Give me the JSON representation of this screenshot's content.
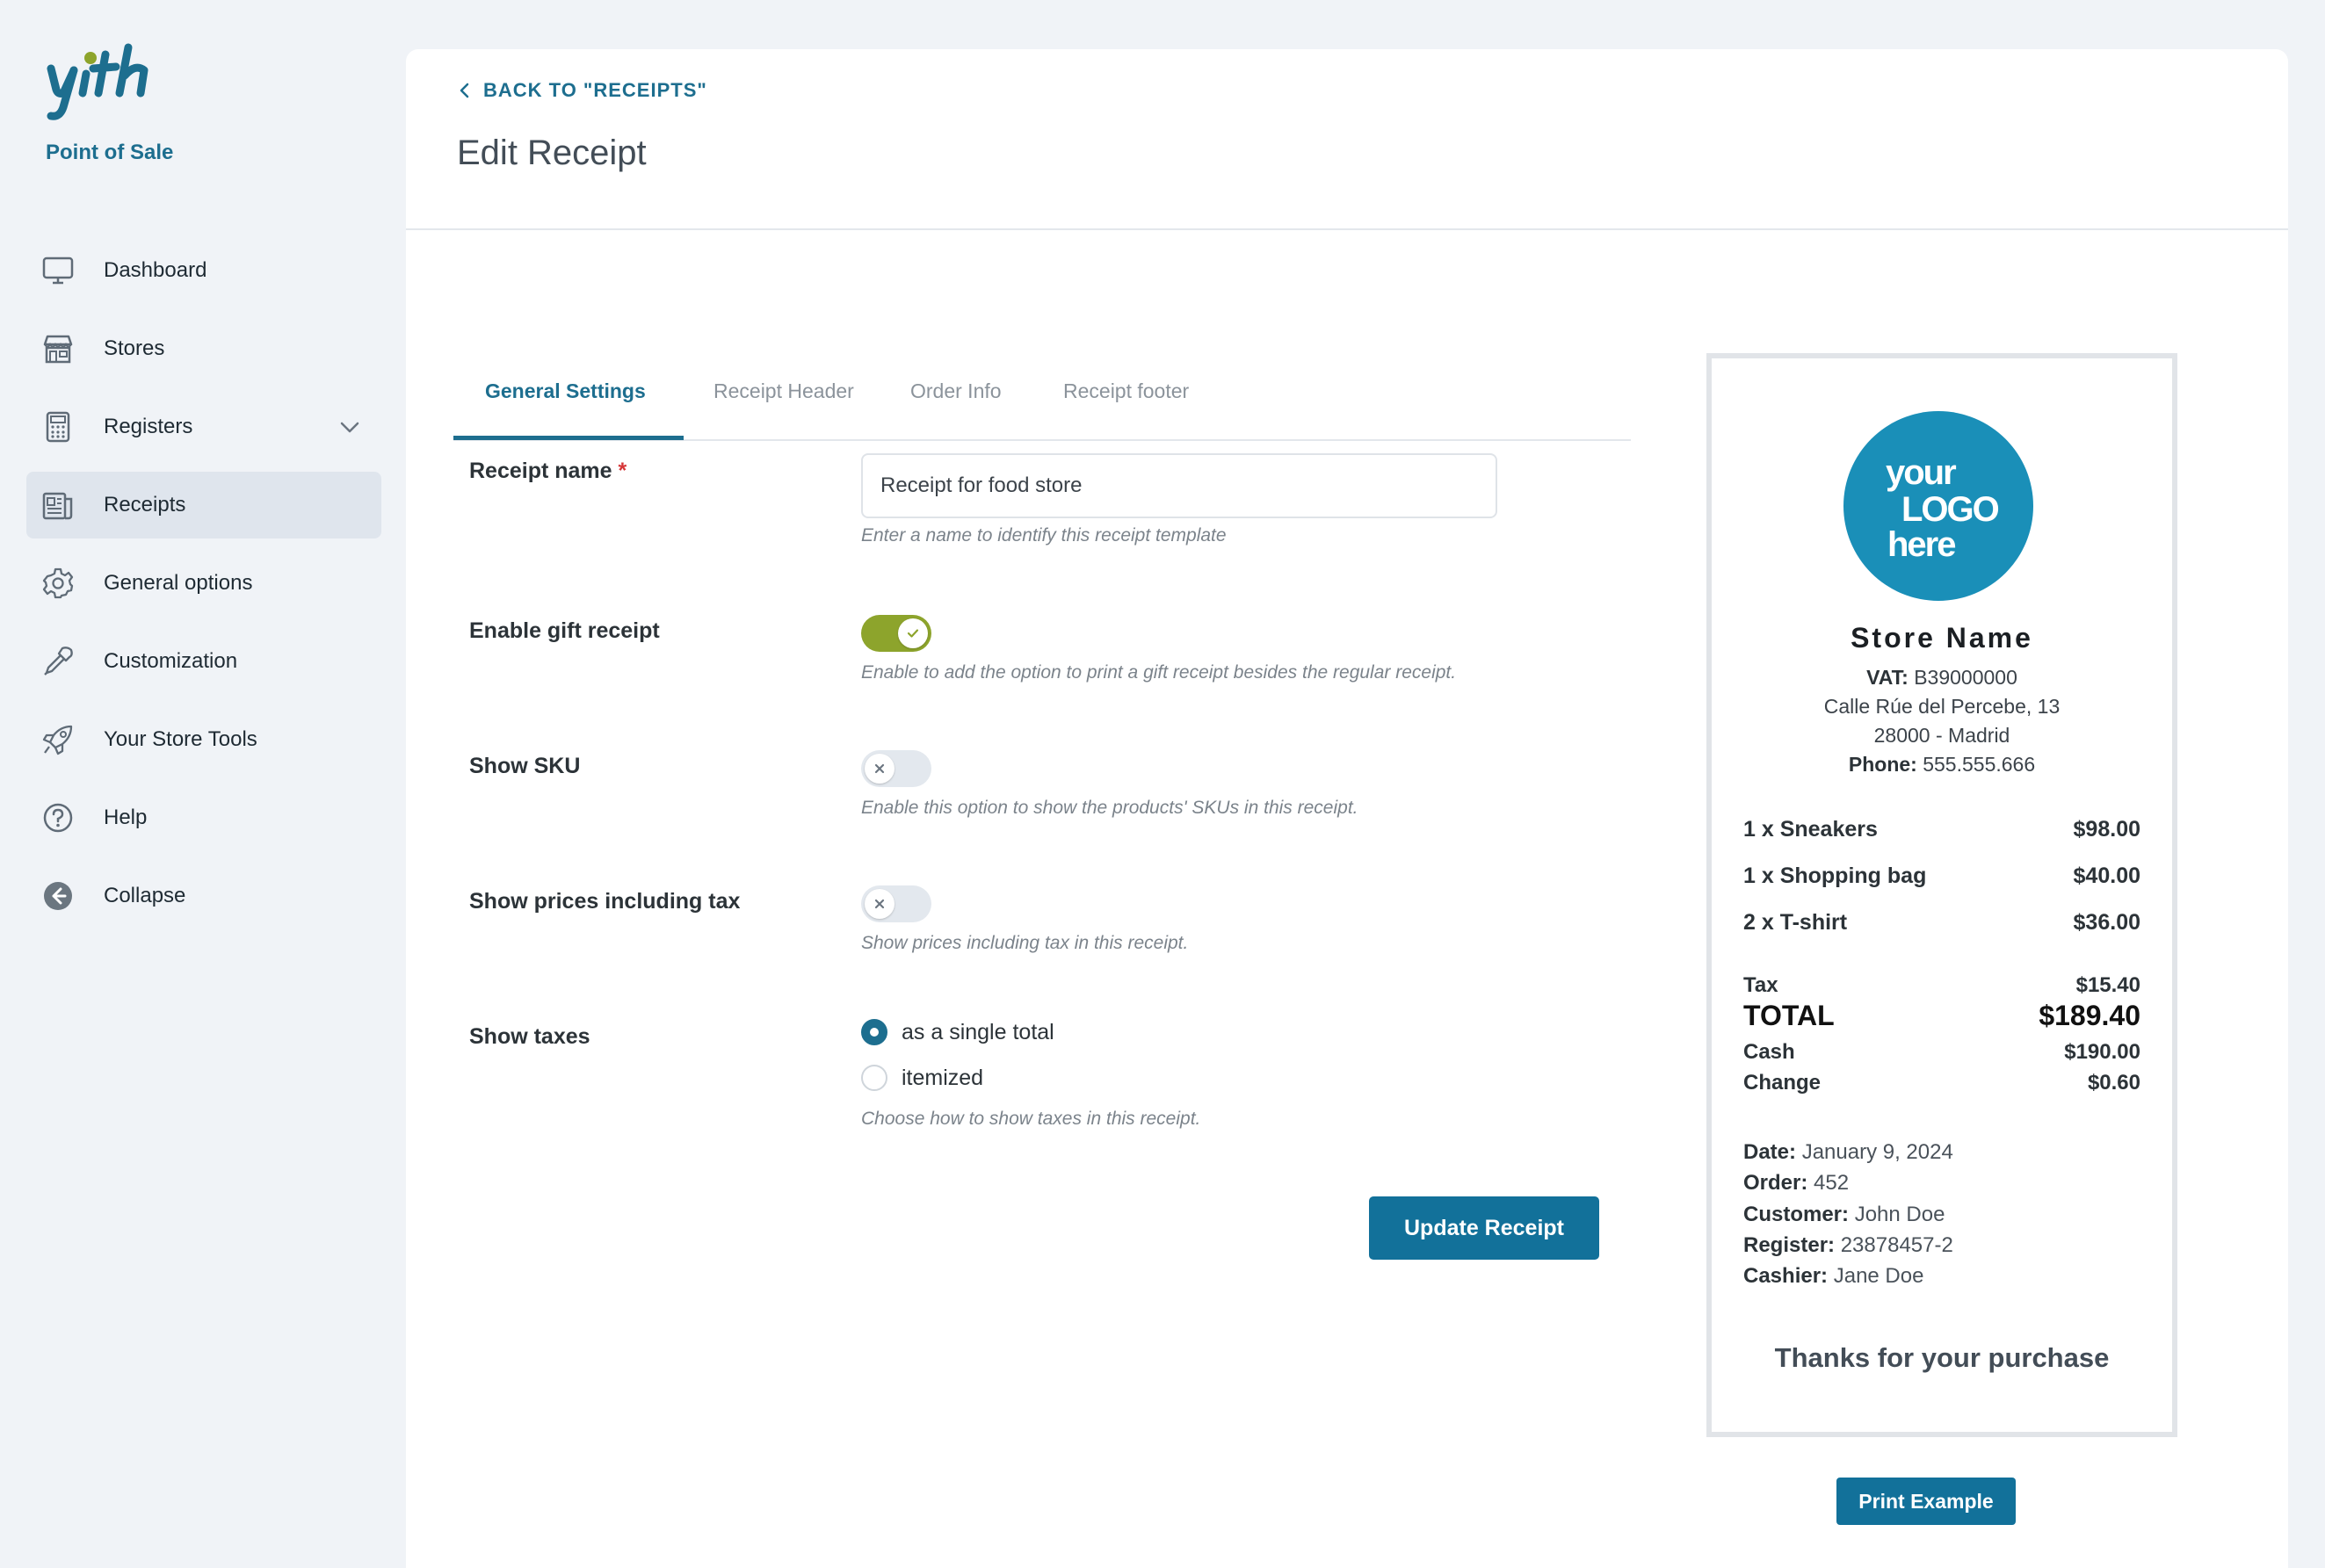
{
  "brand": {
    "logo_text": "yith",
    "app_name": "Point of Sale",
    "accent_color": "#1d6e8f",
    "logo_dot_color": "#8da42c"
  },
  "sidebar": {
    "items": [
      {
        "label": "Dashboard",
        "icon": "monitor-icon"
      },
      {
        "label": "Stores",
        "icon": "store-icon"
      },
      {
        "label": "Registers",
        "icon": "calculator-icon",
        "expandable": true
      },
      {
        "label": "Receipts",
        "icon": "receipt-icon",
        "active": true
      },
      {
        "label": "General options",
        "icon": "gear-icon"
      },
      {
        "label": "Customization",
        "icon": "eyedropper-icon"
      },
      {
        "label": "Your Store Tools",
        "icon": "rocket-icon"
      },
      {
        "label": "Help",
        "icon": "help-icon"
      },
      {
        "label": "Collapse",
        "icon": "collapse-arrow-icon"
      }
    ]
  },
  "header": {
    "back_label": "BACK TO \"RECEIPTS\"",
    "title": "Edit Receipt"
  },
  "tabs": [
    {
      "label": "General Settings",
      "active": true
    },
    {
      "label": "Receipt Header"
    },
    {
      "label": "Order Info"
    },
    {
      "label": "Receipt footer"
    }
  ],
  "form": {
    "receipt_name": {
      "label": "Receipt name",
      "required_mark": "*",
      "value": "Receipt for food store",
      "hint": "Enter a name to identify this receipt template"
    },
    "gift_receipt": {
      "label": "Enable gift receipt",
      "enabled": true,
      "hint": "Enable to add the option to print a gift receipt besides the regular receipt."
    },
    "show_sku": {
      "label": "Show SKU",
      "enabled": false,
      "hint": "Enable this option to show the products' SKUs in this receipt."
    },
    "show_prices_tax": {
      "label": "Show prices including tax",
      "enabled": false,
      "hint": "Show prices including tax in this receipt."
    },
    "show_taxes": {
      "label": "Show taxes",
      "options": [
        "as a single total",
        "itemized"
      ],
      "selected": "as a single total",
      "hint": "Choose how to show taxes in this receipt."
    },
    "submit_label": "Update Receipt"
  },
  "receipt_preview": {
    "logo_lines": [
      "your",
      "LOGO",
      "here"
    ],
    "store_name": "Store Name",
    "vat_label": "VAT:",
    "vat_value": "B39000000",
    "address_line1": "Calle Rúe del Percebe, 13",
    "address_line2": "28000 - Madrid",
    "phone_label": "Phone:",
    "phone_value": "555.555.666",
    "items": [
      {
        "name": "1 x Sneakers",
        "price": "$98.00"
      },
      {
        "name": "1 x Shopping bag",
        "price": "$40.00"
      },
      {
        "name": "2 x T-shirt",
        "price": "$36.00"
      }
    ],
    "tax_label": "Tax",
    "tax_value": "$15.40",
    "total_label": "TOTAL",
    "total_value": "$189.40",
    "cash_label": "Cash",
    "cash_value": "$190.00",
    "change_label": "Change",
    "change_value": "$0.60",
    "date_label": "Date:",
    "date_value": "January 9, 2024",
    "order_label": "Order:",
    "order_value": "452",
    "customer_label": "Customer:",
    "customer_value": "John Doe",
    "register_label": "Register:",
    "register_value": "23878457-2",
    "cashier_label": "Cashier:",
    "cashier_value": "Jane Doe",
    "thanks": "Thanks for your purchase",
    "print_label": "Print Example"
  }
}
